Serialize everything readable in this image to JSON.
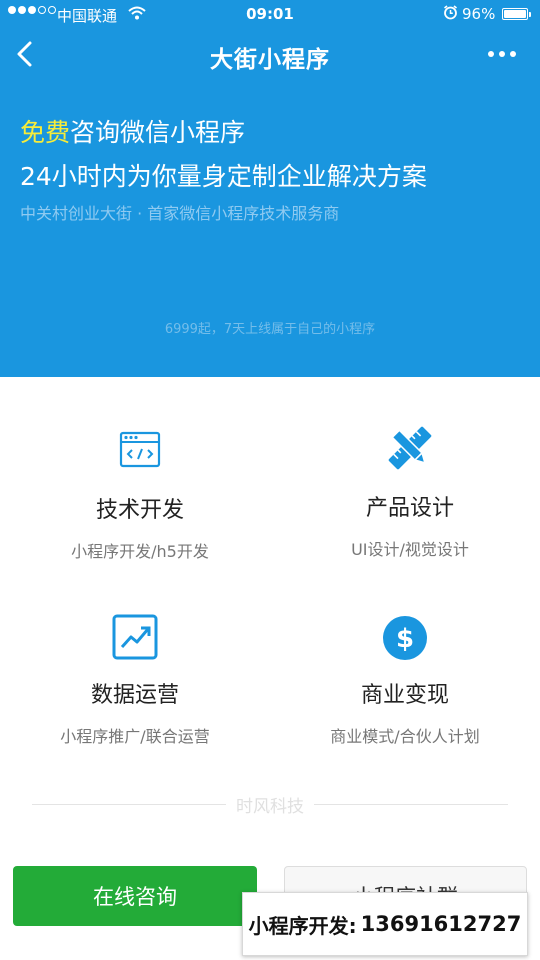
{
  "status_bar": {
    "carrier": "中国联通",
    "time": "09:01",
    "battery": "96%"
  },
  "nav": {
    "title": "大街小程序"
  },
  "hero": {
    "highlight": "免费",
    "line1_rest": "咨询微信小程序",
    "line2": "24小时内为你量身定制企业解决方案",
    "line3": "中关村创业大街 · 首家微信小程序技术服务商",
    "price_note": "6999起，7天上线属于自己的小程序"
  },
  "services": [
    {
      "icon": "code-window-icon",
      "title": "技术开发",
      "desc": "小程序开发/h5开发"
    },
    {
      "icon": "ruler-pencil-icon",
      "title": "产品设计",
      "desc": "UI设计/视觉设计"
    },
    {
      "icon": "trend-chart-icon",
      "title": "数据运营",
      "desc": "小程序推广/联合运营"
    },
    {
      "icon": "dollar-icon",
      "title": "商业变现",
      "desc": "商业模式/合伙人计划"
    }
  ],
  "divider": {
    "brand": "时风科技"
  },
  "actions": {
    "consult": "在线咨询",
    "group": "小程序社群"
  },
  "contact": {
    "label": "小程序开发:",
    "phone": "13691612727"
  },
  "colors": {
    "primary_blue": "#1a96df",
    "highlight_yellow": "#f6ec3a",
    "consult_green": "#23ab38"
  }
}
